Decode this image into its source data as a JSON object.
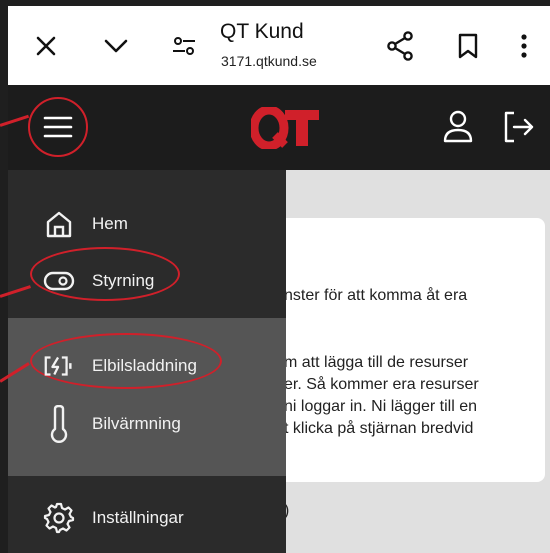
{
  "browser": {
    "tab_title": "QT Kund",
    "url": "3171.qtkund.se"
  },
  "app": {
    "logo_text": "QT"
  },
  "sidebar": {
    "items": [
      {
        "label": "Hem",
        "icon": "home-icon"
      },
      {
        "label": "Styrning",
        "icon": "toggle-icon"
      },
      {
        "label": "Elbilsladdning",
        "icon": "ev-charging-icon"
      },
      {
        "label": "Bilvärmning",
        "icon": "thermometer-icon"
      },
      {
        "label": "Inställningar",
        "icon": "gear-icon"
      }
    ]
  },
  "content": {
    "lines": [
      "nster för att komma åt era",
      "m att lägga till de resurser",
      "er. Så kommer era resurser",
      "ni loggar in. Ni lägger till en",
      "t klicka på stjärnan bredvid"
    ],
    "bottom_text": ")"
  },
  "colors": {
    "accent_red": "#d0202a",
    "header_bg": "#1c1c1c",
    "drawer_bg": "#2b2b2b",
    "drawer_group_bg": "#555555",
    "content_bg": "#e0e0e0"
  }
}
